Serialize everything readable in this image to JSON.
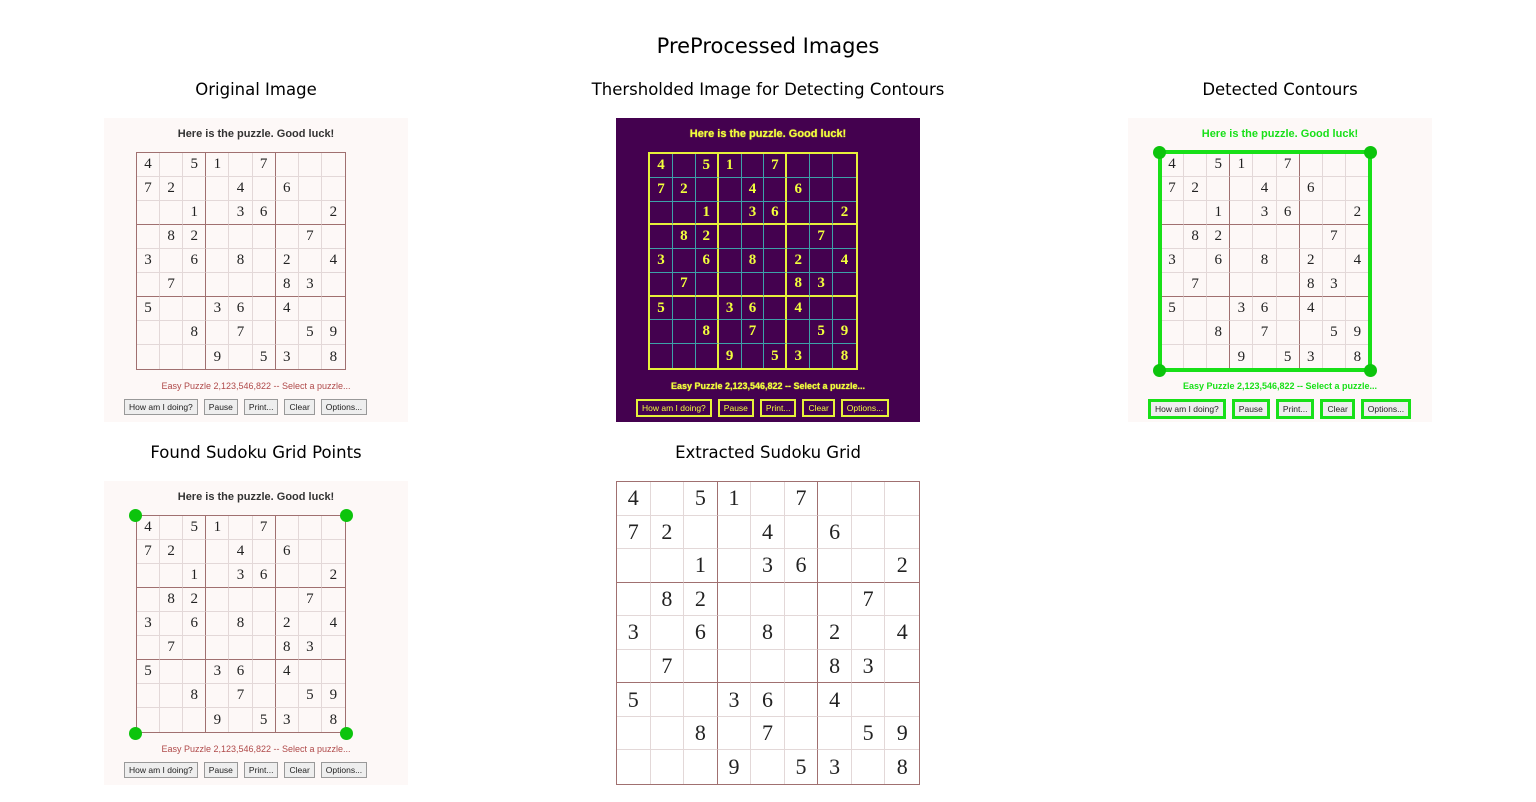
{
  "figure_title": "PreProcessed Images",
  "panels": {
    "original": "Original Image",
    "threshold": "Thersholded Image for Detecting Contours",
    "contours": "Detected Contours",
    "grid_points": "Found Sudoku Grid Points",
    "extracted": "Extracted Sudoku Grid"
  },
  "screenshot": {
    "header": "Here is the puzzle. Good luck!",
    "footer": "Easy Puzzle 2,123,546,822 -- Select a puzzle...",
    "buttons": [
      "How am I doing?",
      "Pause",
      "Print...",
      "Clear",
      "Options..."
    ]
  },
  "sudoku": [
    [
      "4",
      "",
      "5",
      "1",
      "",
      "7",
      "",
      "",
      ""
    ],
    [
      "7",
      "2",
      "",
      "",
      "4",
      "",
      "6",
      "",
      ""
    ],
    [
      "",
      "",
      "1",
      "",
      "3",
      "6",
      "",
      "",
      "2"
    ],
    [
      "",
      "8",
      "2",
      "",
      "",
      "",
      "",
      "7",
      ""
    ],
    [
      "3",
      "",
      "6",
      "",
      "8",
      "",
      "2",
      "",
      "4"
    ],
    [
      "",
      "7",
      "",
      "",
      "",
      "",
      "8",
      "3",
      ""
    ],
    [
      "5",
      "",
      "",
      "3",
      "6",
      "",
      "4",
      "",
      ""
    ],
    [
      "",
      "",
      "8",
      "",
      "7",
      "",
      "",
      "5",
      "9"
    ],
    [
      "",
      "",
      "",
      "9",
      "",
      "5",
      "3",
      "",
      "8"
    ]
  ],
  "colors": {
    "threshold_bg": "#44014f",
    "threshold_fg": "#f2ff3c",
    "contour_green": "#18e018",
    "grid_point": "#0cc40c"
  }
}
